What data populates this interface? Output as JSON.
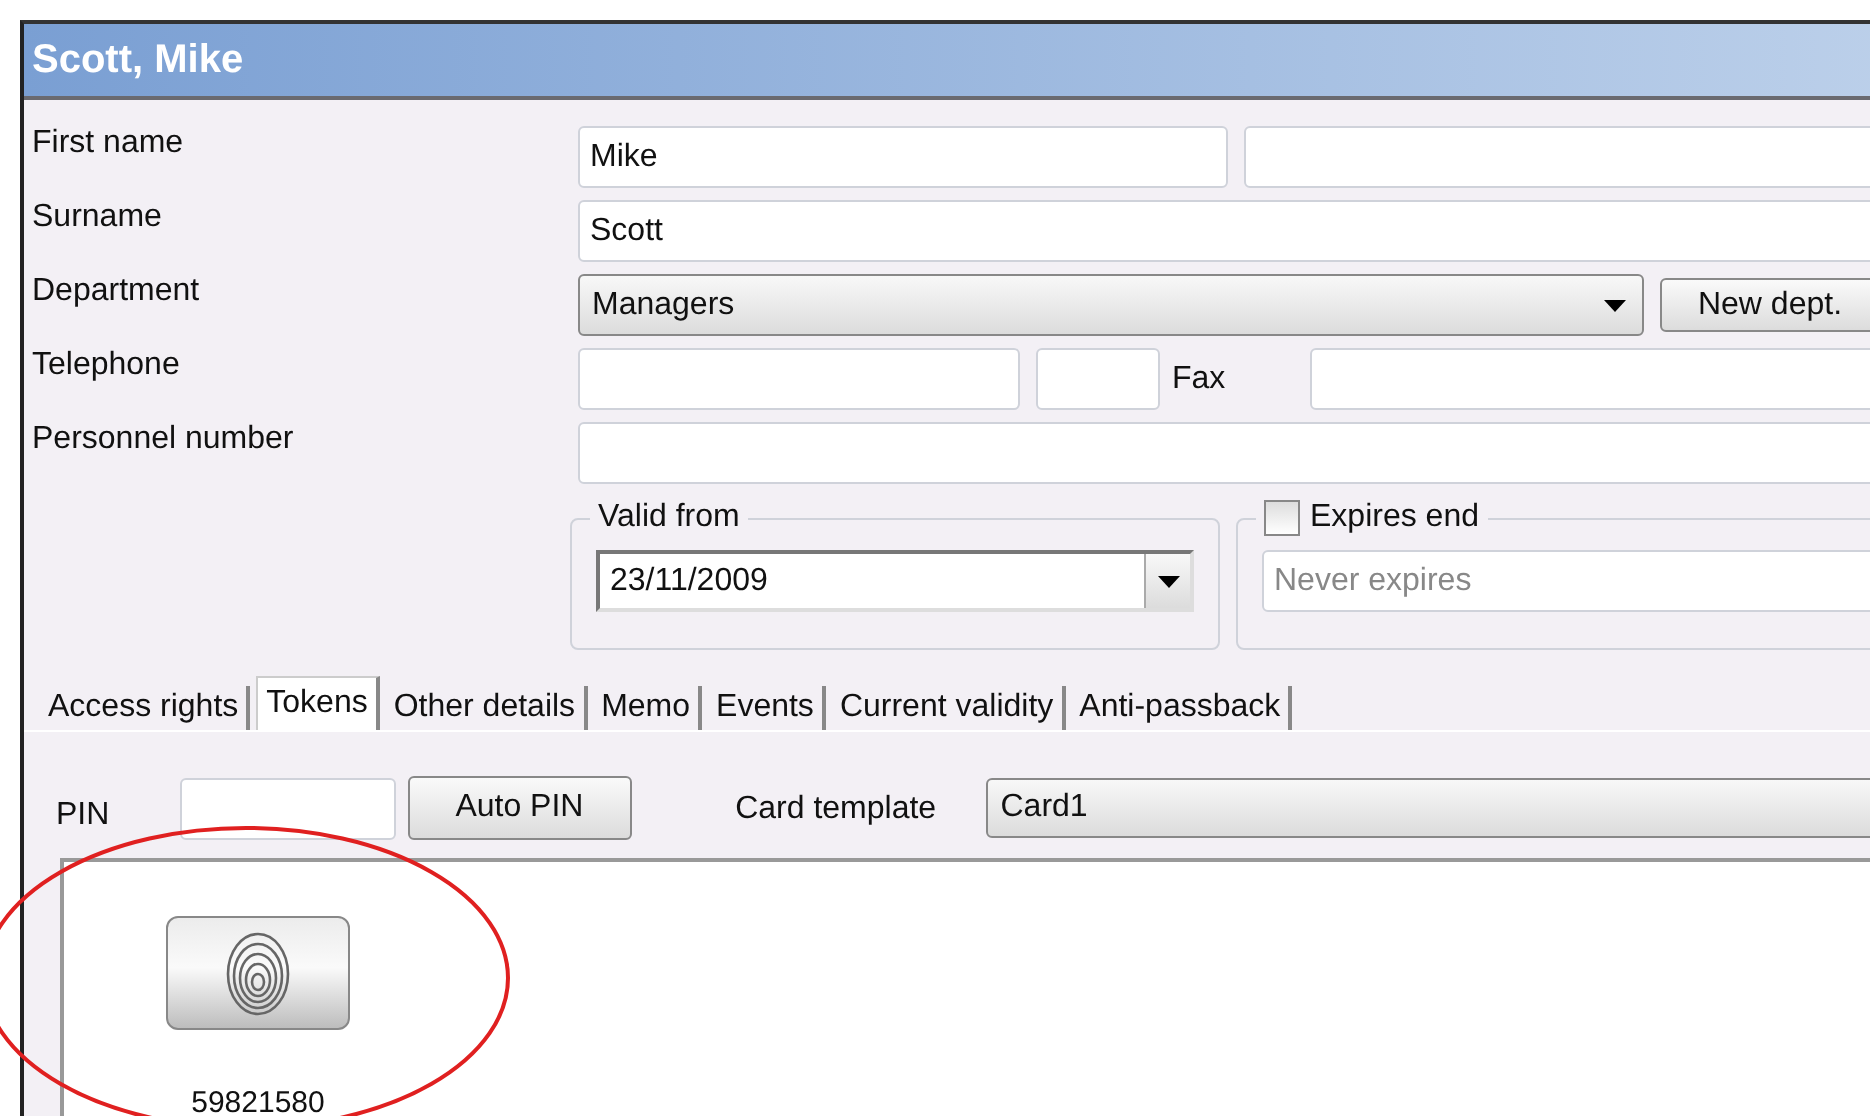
{
  "window": {
    "title": "Scott, Mike"
  },
  "first_name": {
    "label": "First name",
    "value": "Mike"
  },
  "surname": {
    "label": "Surname",
    "value": "Scott"
  },
  "department": {
    "label": "Department",
    "value": "Managers",
    "button": "New dept."
  },
  "telephone": {
    "label": "Telephone",
    "fax_label": "Fax"
  },
  "personnel_number": {
    "label": "Personnel number"
  },
  "valid_from": {
    "label": "Valid from",
    "value": "23/11/2009"
  },
  "expires_end": {
    "label": "Expires end",
    "checked": false,
    "placeholder": "Never expires"
  },
  "tabs": [
    {
      "label": "Access rights",
      "selected": false
    },
    {
      "label": "Tokens",
      "selected": true
    },
    {
      "label": "Other details",
      "selected": false
    },
    {
      "label": "Memo",
      "selected": false
    },
    {
      "label": "Events",
      "selected": false
    },
    {
      "label": "Current validity",
      "selected": false
    },
    {
      "label": "Anti-passback",
      "selected": false
    }
  ],
  "tokens_panel": {
    "pin_label": "PIN",
    "auto_pin_button": "Auto PIN",
    "card_template_label": "Card template",
    "card_template": "Card1",
    "tokens": [
      {
        "number": "59821580"
      }
    ]
  }
}
